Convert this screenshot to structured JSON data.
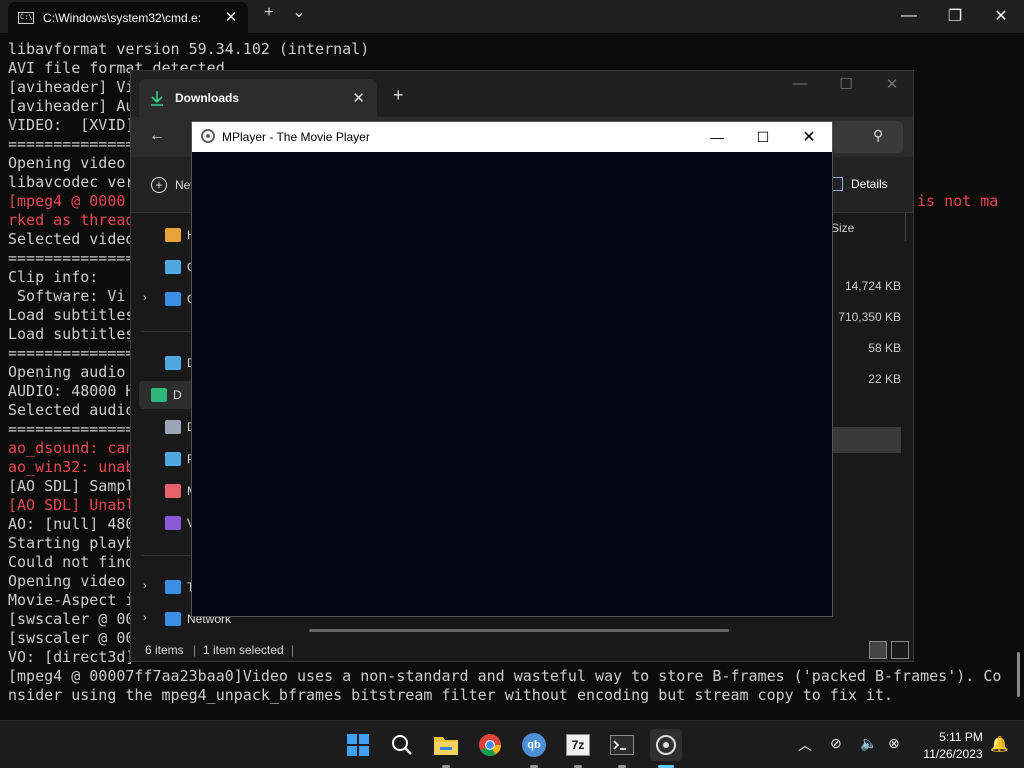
{
  "terminal": {
    "tab_title": "C:\\Windows\\system32\\cmd.e:",
    "new_tab_glyph": "+",
    "dropdown_glyph": "⌄",
    "lines": [
      {
        "text": "libavformat version 59.34.102 (internal)",
        "kind": "normal"
      },
      {
        "text": "AVI file format detected.",
        "kind": "normal"
      },
      {
        "text": "[aviheader] Vi",
        "kind": "normal"
      },
      {
        "text": "[aviheader] Au",
        "kind": "normal"
      },
      {
        "text": "VIDEO:  [XVID]",
        "kind": "normal"
      },
      {
        "text": "===============",
        "kind": "normal"
      },
      {
        "text": "Opening video",
        "kind": "normal"
      },
      {
        "text": "libavcodec ver",
        "kind": "normal"
      },
      {
        "text": "[mpeg4 @ 0000",
        "kind": "err",
        "tail": "is not ma"
      },
      {
        "text": "rked as thread",
        "kind": "err"
      },
      {
        "text": "Selected video",
        "kind": "normal"
      },
      {
        "text": "===============",
        "kind": "normal"
      },
      {
        "text": "Clip info:",
        "kind": "normal"
      },
      {
        "text": " Software: Vi",
        "kind": "normal"
      },
      {
        "text": "Load subtitles",
        "kind": "normal"
      },
      {
        "text": "Load subtitles",
        "kind": "normal"
      },
      {
        "text": "===============",
        "kind": "normal"
      },
      {
        "text": "Opening audio",
        "kind": "normal"
      },
      {
        "text": "AUDIO: 48000 H",
        "kind": "normal"
      },
      {
        "text": "Selected audio",
        "kind": "normal"
      },
      {
        "text": "===============",
        "kind": "normal"
      },
      {
        "text": "ao_dsound: can",
        "kind": "err"
      },
      {
        "text": "ao_win32: unab",
        "kind": "err"
      },
      {
        "text": "[AO SDL] Sampl",
        "kind": "normal"
      },
      {
        "text": "[AO SDL] Unabl",
        "kind": "err"
      },
      {
        "text": "AO: [null] 480",
        "kind": "normal"
      },
      {
        "text": "Starting playb",
        "kind": "normal"
      },
      {
        "text": "Could not find",
        "kind": "normal"
      },
      {
        "text": "Opening video",
        "kind": "normal"
      },
      {
        "text": "Movie-Aspect i",
        "kind": "normal"
      },
      {
        "text": "[swscaler @ 00",
        "kind": "normal"
      },
      {
        "text": "[swscaler @ 00",
        "kind": "normal"
      },
      {
        "text": "VO: [direct3d]",
        "kind": "normal"
      },
      {
        "text": "[mpeg4 @ 00007ff7aa23baa0]Video uses a non-standard and wasteful way to store B-frames ('packed B-frames'). Co",
        "kind": "normal"
      },
      {
        "text": "nsider using the mpeg4_unpack_bframes bitstream filter without encoding but stream copy to fix it.",
        "kind": "normal"
      }
    ]
  },
  "explorer": {
    "tab_title": "Downloads",
    "new_label": "New",
    "details_label": "Details",
    "size_header": "Size",
    "nav": [
      {
        "label": "H",
        "color": "#e8a33b"
      },
      {
        "label": "G",
        "color": "#4fa8e0"
      },
      {
        "label": "O",
        "color": "#3a8ee6",
        "chevron": true
      },
      {
        "label": "D",
        "color": "#4fa8e0"
      },
      {
        "label": "D",
        "color": "#2fb67a",
        "selected": true
      },
      {
        "label": "D",
        "color": "#9aa6b8"
      },
      {
        "label": "P",
        "color": "#4fa8e0"
      },
      {
        "label": "M",
        "color": "#e8606a"
      },
      {
        "label": "V",
        "color": "#8a5ad6"
      },
      {
        "label": "T",
        "color": "#3a8ee6",
        "chevron": true
      },
      {
        "label": "Network",
        "color": "#3a8ee6",
        "chevron": true
      }
    ],
    "sizes": [
      "14,724 KB",
      "710,350 KB",
      "58 KB",
      "22 KB"
    ],
    "status_items": "6 items",
    "status_selected": "1 item selected"
  },
  "mplayer": {
    "title": "MPlayer - The Movie Player"
  },
  "taskbar": {
    "apps": [
      "start-icon",
      "search-icon",
      "file-explorer-icon",
      "chrome-icon",
      "qbittorrent-icon",
      "7zip-icon",
      "terminal-icon",
      "mplayer-icon"
    ],
    "qb_label": "qb",
    "zip_label": "7z",
    "time": "5:11 PM",
    "date": "11/26/2023"
  }
}
